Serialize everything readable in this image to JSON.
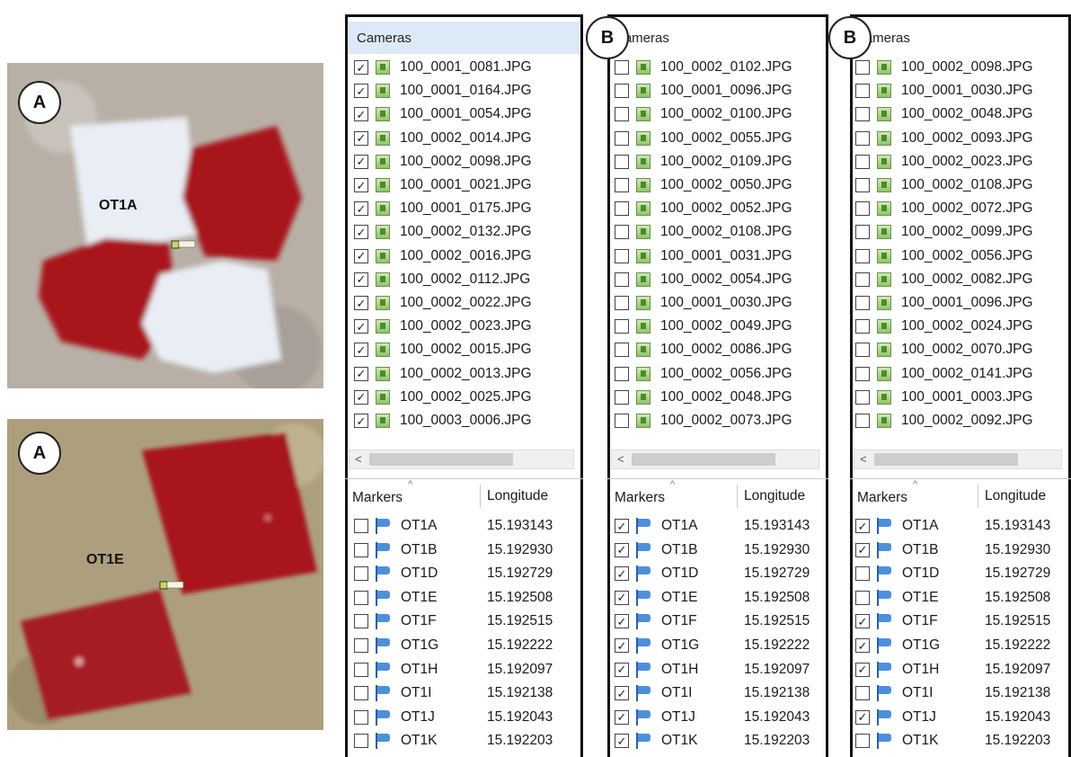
{
  "photos": [
    {
      "tag": "A",
      "label": "OT1A",
      "marker": "OT1A"
    },
    {
      "tag": "A",
      "label": "OT1E",
      "marker": "OT1E"
    }
  ],
  "panels": [
    {
      "tag": "",
      "cameras_header": "Cameras",
      "cameras": [
        {
          "name": "100_0001_0081.JPG",
          "checked": true
        },
        {
          "name": "100_0001_0164.JPG",
          "checked": true
        },
        {
          "name": "100_0001_0054.JPG",
          "checked": true
        },
        {
          "name": "100_0002_0014.JPG",
          "checked": true
        },
        {
          "name": "100_0002_0098.JPG",
          "checked": true
        },
        {
          "name": "100_0001_0021.JPG",
          "checked": true
        },
        {
          "name": "100_0001_0175.JPG",
          "checked": true
        },
        {
          "name": "100_0002_0132.JPG",
          "checked": true
        },
        {
          "name": "100_0002_0016.JPG",
          "checked": true
        },
        {
          "name": "100_0002_0112.JPG",
          "checked": true
        },
        {
          "name": "100_0002_0022.JPG",
          "checked": true
        },
        {
          "name": "100_0002_0023.JPG",
          "checked": true
        },
        {
          "name": "100_0002_0015.JPG",
          "checked": true
        },
        {
          "name": "100_0002_0013.JPG",
          "checked": true
        },
        {
          "name": "100_0002_0025.JPG",
          "checked": true
        },
        {
          "name": "100_0003_0006.JPG",
          "checked": true
        }
      ],
      "markers_header": "Markers",
      "longitude_header": "Longitude",
      "markers": [
        {
          "name": "OT1A",
          "lon": "15.193143",
          "checked": false
        },
        {
          "name": "OT1B",
          "lon": "15.192930",
          "checked": false
        },
        {
          "name": "OT1D",
          "lon": "15.192729",
          "checked": false
        },
        {
          "name": "OT1E",
          "lon": "15.192508",
          "checked": false
        },
        {
          "name": "OT1F",
          "lon": "15.192515",
          "checked": false
        },
        {
          "name": "OT1G",
          "lon": "15.192222",
          "checked": false
        },
        {
          "name": "OT1H",
          "lon": "15.192097",
          "checked": false
        },
        {
          "name": "OT1I",
          "lon": "15.192138",
          "checked": false
        },
        {
          "name": "OT1J",
          "lon": "15.192043",
          "checked": false
        },
        {
          "name": "OT1K",
          "lon": "15.192203",
          "checked": false
        }
      ]
    },
    {
      "tag": "B",
      "cameras_header": "Cameras",
      "cameras": [
        {
          "name": "100_0002_0102.JPG",
          "checked": false
        },
        {
          "name": "100_0001_0096.JPG",
          "checked": false
        },
        {
          "name": "100_0002_0100.JPG",
          "checked": false
        },
        {
          "name": "100_0002_0055.JPG",
          "checked": false
        },
        {
          "name": "100_0002_0109.JPG",
          "checked": false
        },
        {
          "name": "100_0002_0050.JPG",
          "checked": false
        },
        {
          "name": "100_0002_0052.JPG",
          "checked": false
        },
        {
          "name": "100_0002_0108.JPG",
          "checked": false
        },
        {
          "name": "100_0001_0031.JPG",
          "checked": false
        },
        {
          "name": "100_0002_0054.JPG",
          "checked": false
        },
        {
          "name": "100_0001_0030.JPG",
          "checked": false
        },
        {
          "name": "100_0002_0049.JPG",
          "checked": false
        },
        {
          "name": "100_0002_0086.JPG",
          "checked": false
        },
        {
          "name": "100_0002_0056.JPG",
          "checked": false
        },
        {
          "name": "100_0002_0048.JPG",
          "checked": false
        },
        {
          "name": "100_0002_0073.JPG",
          "checked": false
        }
      ],
      "markers_header": "Markers",
      "longitude_header": "Longitude",
      "markers": [
        {
          "name": "OT1A",
          "lon": "15.193143",
          "checked": true
        },
        {
          "name": "OT1B",
          "lon": "15.192930",
          "checked": true
        },
        {
          "name": "OT1D",
          "lon": "15.192729",
          "checked": true
        },
        {
          "name": "OT1E",
          "lon": "15.192508",
          "checked": true
        },
        {
          "name": "OT1F",
          "lon": "15.192515",
          "checked": true
        },
        {
          "name": "OT1G",
          "lon": "15.192222",
          "checked": true
        },
        {
          "name": "OT1H",
          "lon": "15.192097",
          "checked": true
        },
        {
          "name": "OT1I",
          "lon": "15.192138",
          "checked": true
        },
        {
          "name": "OT1J",
          "lon": "15.192043",
          "checked": true
        },
        {
          "name": "OT1K",
          "lon": "15.192203",
          "checked": true
        }
      ]
    },
    {
      "tag": "B",
      "cameras_header": "Cameras",
      "cameras": [
        {
          "name": "100_0002_0098.JPG",
          "checked": false
        },
        {
          "name": "100_0001_0030.JPG",
          "checked": false
        },
        {
          "name": "100_0002_0048.JPG",
          "checked": false
        },
        {
          "name": "100_0002_0093.JPG",
          "checked": false
        },
        {
          "name": "100_0002_0023.JPG",
          "checked": false
        },
        {
          "name": "100_0002_0108.JPG",
          "checked": false
        },
        {
          "name": "100_0002_0072.JPG",
          "checked": false
        },
        {
          "name": "100_0002_0099.JPG",
          "checked": false
        },
        {
          "name": "100_0002_0056.JPG",
          "checked": false
        },
        {
          "name": "100_0002_0082.JPG",
          "checked": false
        },
        {
          "name": "100_0001_0096.JPG",
          "checked": false
        },
        {
          "name": "100_0002_0024.JPG",
          "checked": false
        },
        {
          "name": "100_0002_0070.JPG",
          "checked": false
        },
        {
          "name": "100_0002_0141.JPG",
          "checked": false
        },
        {
          "name": "100_0001_0003.JPG",
          "checked": false
        },
        {
          "name": "100_0002_0092.JPG",
          "checked": false
        }
      ],
      "markers_header": "Markers",
      "longitude_header": "Longitude",
      "markers": [
        {
          "name": "OT1A",
          "lon": "15.193143",
          "checked": true
        },
        {
          "name": "OT1B",
          "lon": "15.192930",
          "checked": true
        },
        {
          "name": "OT1D",
          "lon": "15.192729",
          "checked": false
        },
        {
          "name": "OT1E",
          "lon": "15.192508",
          "checked": false
        },
        {
          "name": "OT1F",
          "lon": "15.192515",
          "checked": true
        },
        {
          "name": "OT1G",
          "lon": "15.192222",
          "checked": true
        },
        {
          "name": "OT1H",
          "lon": "15.192097",
          "checked": true
        },
        {
          "name": "OT1I",
          "lon": "15.192138",
          "checked": false
        },
        {
          "name": "OT1J",
          "lon": "15.192043",
          "checked": true
        },
        {
          "name": "OT1K",
          "lon": "15.192203",
          "checked": false
        }
      ]
    }
  ],
  "colors": {
    "target_red": "#a8141c",
    "target_white": "#e9edf4",
    "ground": "#b7aea3",
    "ground2": "#a89a7b",
    "selected_header": "#dce9f7"
  }
}
